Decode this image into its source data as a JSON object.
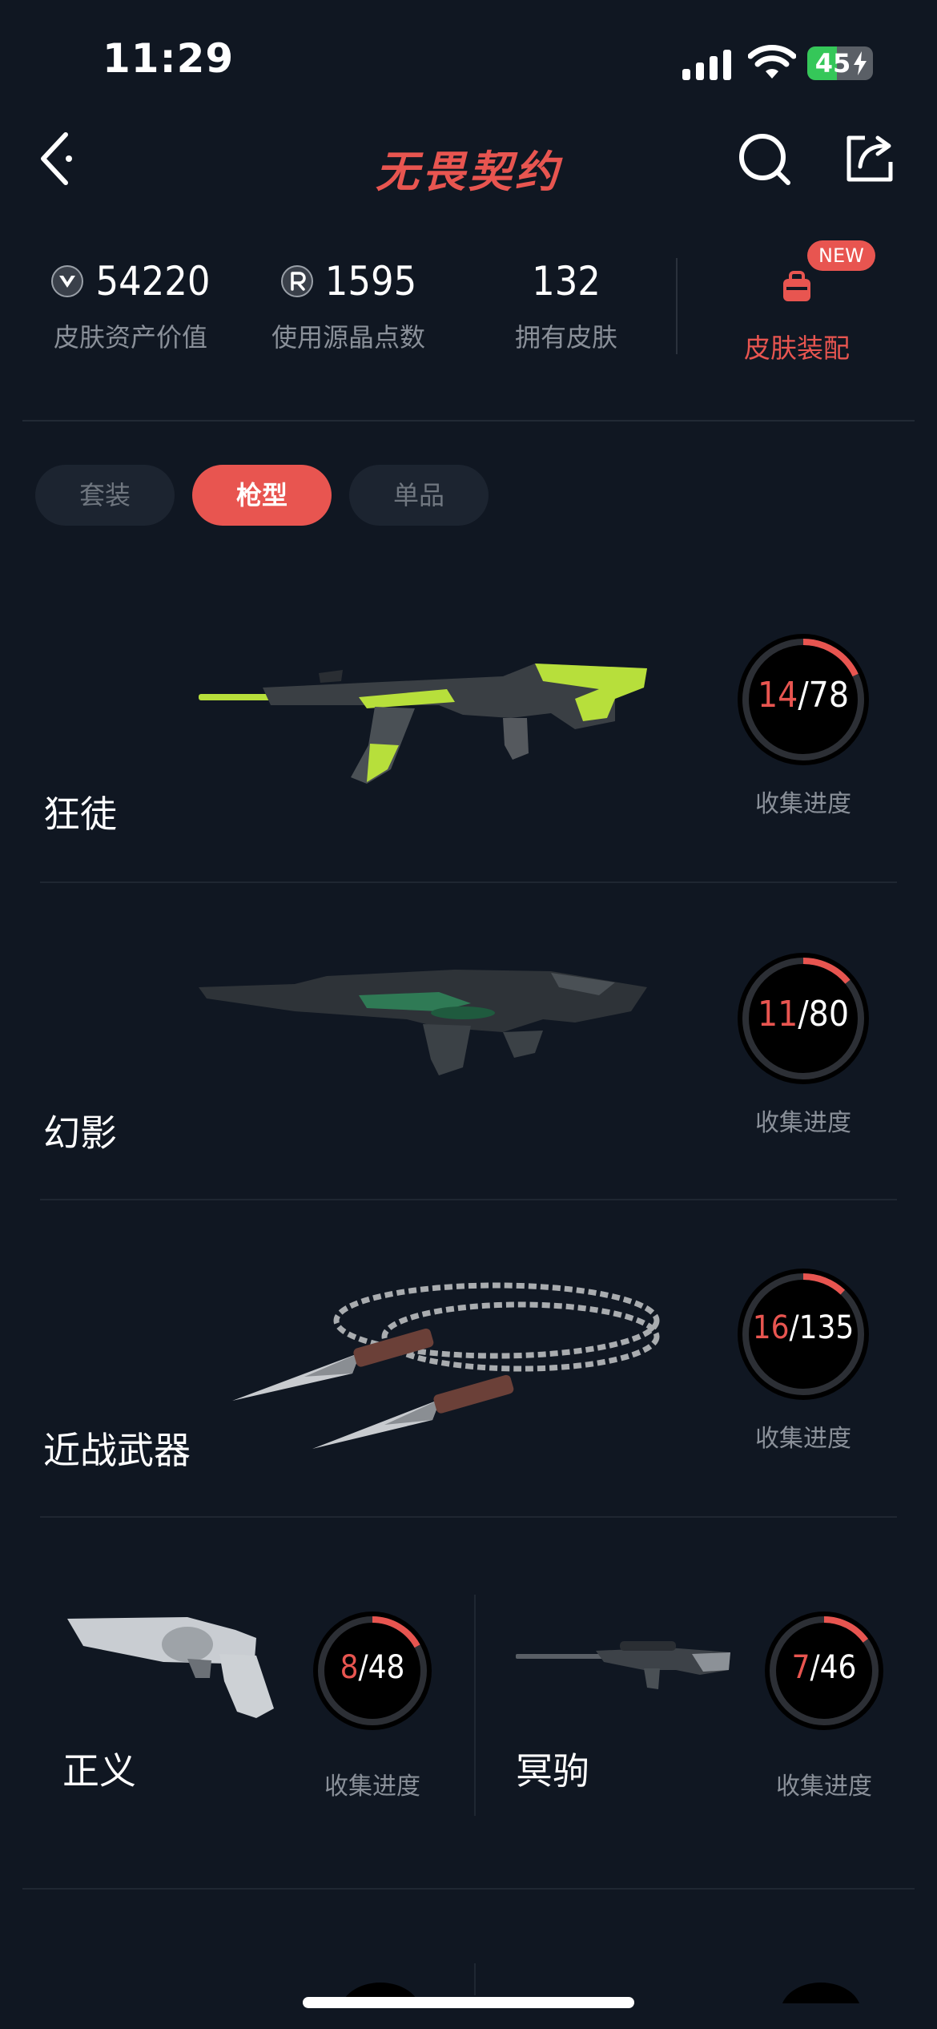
{
  "status": {
    "time": "11:29",
    "battery": "45",
    "battery_level": 0.45
  },
  "nav": {
    "logo": "无畏契约"
  },
  "stats": [
    {
      "icon": "valorant-points-icon",
      "value": "54220",
      "label": "皮肤资产价值"
    },
    {
      "icon": "radianite-icon",
      "value": "1595",
      "label": "使用源晶点数"
    },
    {
      "icon": "",
      "value": "132",
      "label": "拥有皮肤"
    }
  ],
  "equip": {
    "badge": "NEW",
    "label": "皮肤装配"
  },
  "tabs": [
    {
      "label": "套装",
      "active": false
    },
    {
      "label": "枪型",
      "active": true
    },
    {
      "label": "单品",
      "active": false
    }
  ],
  "weapons": [
    {
      "name": "狂徒",
      "owned": "14",
      "total": "78",
      "progress_label": "收集进度",
      "fraction": 0.18
    },
    {
      "name": "幻影",
      "owned": "11",
      "total": "80",
      "progress_label": "收集进度",
      "fraction": 0.14
    },
    {
      "name": "近战武器",
      "owned": "16",
      "total": "135",
      "progress_label": "收集进度",
      "fraction": 0.12
    },
    {
      "name": "正义",
      "owned": "8",
      "total": "48",
      "progress_label": "收集进度",
      "fraction": 0.17
    },
    {
      "name": "冥驹",
      "owned": "7",
      "total": "46",
      "progress_label": "收集进度",
      "fraction": 0.15
    }
  ],
  "colors": {
    "accent": "#e85550",
    "background": "#101722",
    "ring_track": "#2c2f35"
  }
}
